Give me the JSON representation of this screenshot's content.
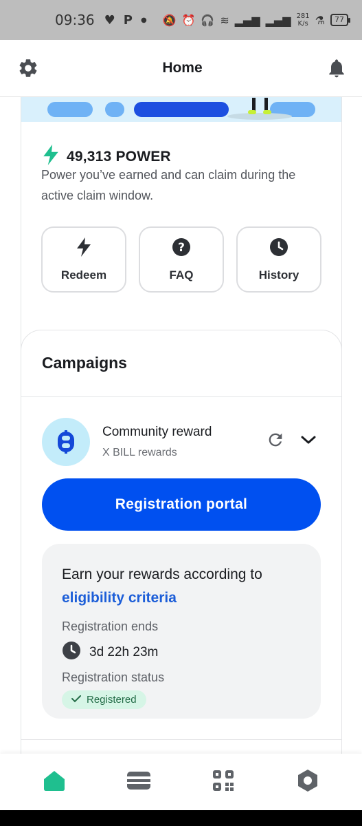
{
  "status_bar": {
    "time": "09:36",
    "net_speed_value": "281",
    "net_speed_unit": "K/s",
    "battery": "77",
    "icons": [
      "heart-monitor-icon",
      "parking-icon",
      "dot-icon",
      "mute-icon",
      "alarm-icon",
      "headset-icon",
      "wifi-icon",
      "signal-icon",
      "signal-icon",
      "lab-icon"
    ]
  },
  "header": {
    "title": "Home",
    "left_icon": "gear-icon",
    "right_icon": "bell-icon"
  },
  "power": {
    "value": "49,313 POWER",
    "description": "Power you’ve earned and can claim during the active claim window.",
    "actions": [
      {
        "label": "Redeem",
        "icon": "lightning-icon"
      },
      {
        "label": "FAQ",
        "icon": "question-icon"
      },
      {
        "label": "History",
        "icon": "clock-icon"
      }
    ],
    "accent_color": "#1fbf8f"
  },
  "campaigns": {
    "title": "Campaigns",
    "item": {
      "name": "Community reward",
      "subtitle": "X BILL rewards",
      "logo_icon": "bill-coin-icon",
      "primary_button": "Registration portal",
      "earn_text": "Earn your rewards according to",
      "earn_link": "eligibility criteria",
      "ends_label": "Registration ends",
      "ends_value": "3d 22h 23m",
      "status_label": "Registration status",
      "status_value": "Registered"
    }
  },
  "bottom_nav": {
    "items": [
      {
        "icon": "home-icon",
        "active": true
      },
      {
        "icon": "wallet-icon",
        "active": false
      },
      {
        "icon": "qr-code-icon",
        "active": false
      },
      {
        "icon": "settings-icon",
        "active": false
      }
    ],
    "active_color": "#1fbf8f",
    "inactive_color": "#5f6368"
  },
  "colors": {
    "primary": "#0050f0",
    "link": "#1d5ed8",
    "success_bg": "#d6f5e6",
    "success_text": "#226b46"
  }
}
